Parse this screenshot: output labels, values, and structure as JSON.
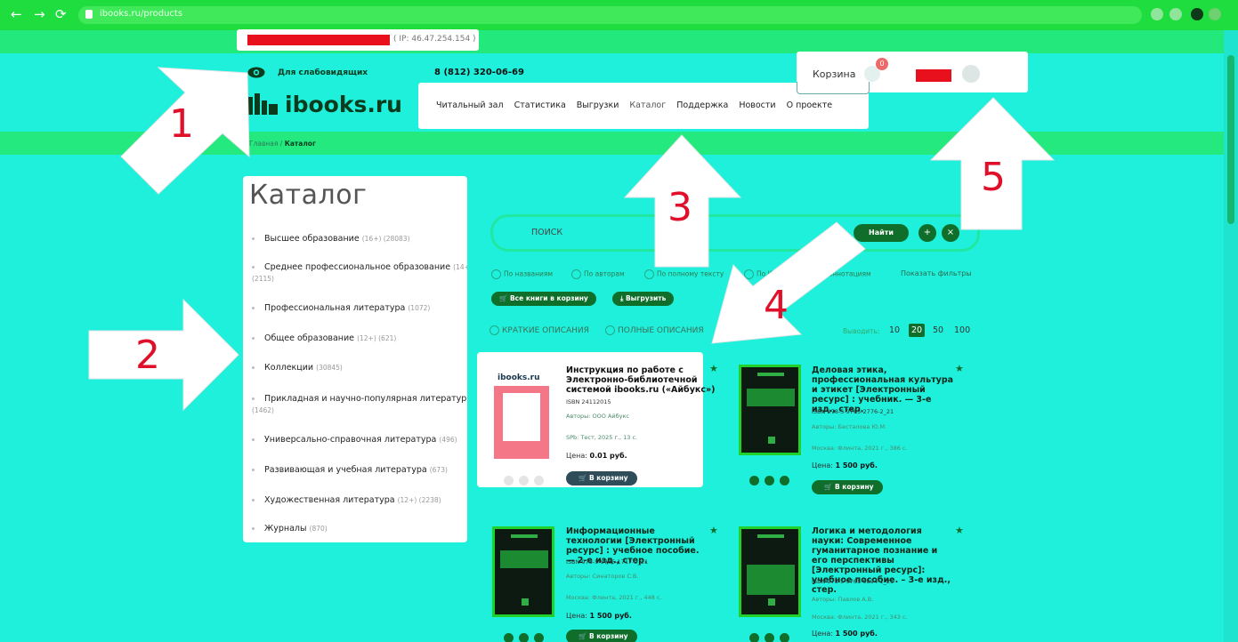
{
  "browser": {
    "url": "ibooks.ru/products"
  },
  "header": {
    "ip_text": "( IP: 46.47.254.154 )",
    "low_vision": "Для слабовидящих",
    "phone": "8 (812) 320-06-69",
    "logo": "ibooks.ru",
    "menu": [
      "Читальный зал",
      "Статистика",
      "Выгрузки",
      "Каталог",
      "Поддержка",
      "Новости",
      "О проекте"
    ],
    "cart_label": "Корзина",
    "cart_count": "0"
  },
  "breadcrumb": {
    "home": "Главная",
    "sep": "/",
    "current": "Каталог"
  },
  "sidebar": {
    "title": "Каталог",
    "items": [
      {
        "label": "Высшее образование",
        "count": "(16+) (28083)"
      },
      {
        "label": "Среднее профессиональное образование",
        "count": "(14+) (2115)"
      },
      {
        "label": "Профессиональная литература",
        "count": "(1072)"
      },
      {
        "label": "Общее образование",
        "count": "(12+) (621)"
      },
      {
        "label": "Коллекции",
        "count": "(30845)"
      },
      {
        "label": "Прикладная и научно-популярная литература",
        "count": "(1462)"
      },
      {
        "label": "Универсально-справочная литература",
        "count": "(496)"
      },
      {
        "label": "Развивающая и учебная литература",
        "count": "(673)"
      },
      {
        "label": "Художественная литература",
        "count": "(12+) (2238)"
      },
      {
        "label": "Журналы",
        "count": "(870)"
      }
    ]
  },
  "search": {
    "placeholder": "ПОИСК",
    "find": "Найти",
    "plus": "+",
    "clear": "×",
    "filters": [
      "По названиям",
      "По авторам",
      "По полному тексту",
      "По ISBN",
      "По аннотациям"
    ],
    "show_filters": "Показать фильтры",
    "all_to_cart": "Все книги в корзину",
    "export": "Выгрузить",
    "view_short": "КРАТКИЕ ОПИСАНИЯ",
    "view_full": "ПОЛНЫЕ ОПИСАНИЯ",
    "per_page_label": "Выводить:",
    "per_page": [
      "10",
      "20",
      "50",
      "100"
    ]
  },
  "books": [
    {
      "title": "Инструкция по работе с Электронно-библиотечной системой ibooks.ru («Айбукс»)",
      "isbn": "ISBN 24112015",
      "authors": "Авторы: ООО Айбукс",
      "publisher": "SPb: Тест, 2025 г., 13 с.",
      "price_label": "Цена:",
      "price": "0.01 руб.",
      "cover_brand": "ibooks.ru",
      "cart": "В корзину"
    },
    {
      "title": "Деловая этика, профессиональная культура и этикет [Электронный ресурс] : учебник. — 3-е изд., стер.",
      "isbn": "ISBN 978-5-9765-2776-2_21",
      "authors": "Авторы: Бесталова Ю.М.",
      "publisher": "Москва: Флинта, 2021 г., 386 с.",
      "price_label": "Цена:",
      "price": "1 500 руб.",
      "cart": "В корзину"
    },
    {
      "title": "Информационные технологии [Электронный ресурс] : учебное пособие. — 2-е изд., стер.",
      "isbn": "ISBN 978-5-9765-1717-2_21",
      "authors": "Авторы: Синаторов С.В.",
      "publisher": "Москва: Флинта, 2021 г., 448 с.",
      "price_label": "Цена:",
      "price": "1 500 руб.",
      "cart": "В корзину"
    },
    {
      "title": "Логика и методология науки: Современное гуманитарное познание и его перспективы [Электронный ресурс]: учебное пособие. – 3-е изд., стер.",
      "isbn": "ISBN 978-5-9765-0894-1_21",
      "authors": "Авторы: Павлов А.В.",
      "publisher": "Москва: Флинта, 2021 г., 343 с.",
      "price_label": "Цена:",
      "price": "1 500 руб."
    }
  ],
  "annotations": {
    "labels": [
      "1",
      "2",
      "3",
      "4",
      "5"
    ],
    "color": "#e0102a"
  },
  "colors": {
    "page_background": "#1ef0dc",
    "accent_green": "#0f6f2a",
    "browser_bar": "#1fdc3f"
  }
}
